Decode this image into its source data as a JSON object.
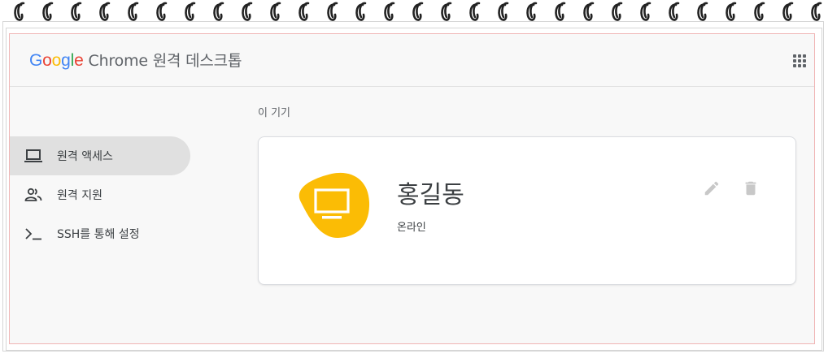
{
  "header": {
    "logo_letters": [
      "G",
      "o",
      "o",
      "g",
      "l",
      "e"
    ],
    "product": "Chrome 원격 데스크톱"
  },
  "nav": {
    "items": [
      {
        "label": "원격 액세스",
        "icon": "laptop-icon",
        "active": true
      },
      {
        "label": "원격 지원",
        "icon": "people-icon",
        "active": false
      },
      {
        "label": "SSH를 통해 설정",
        "icon": "terminal-icon",
        "active": false
      }
    ]
  },
  "main": {
    "section_title": "이 기기",
    "device": {
      "name": "홍길동",
      "status": "온라인",
      "icon": "monitor-icon",
      "blob_color": "#fbbc05"
    },
    "actions": [
      "edit-icon",
      "delete-icon"
    ]
  },
  "colors": {
    "accent": "#fbbc05",
    "active_nav_bg": "#e0e0e0",
    "action_icon": "#c8c8c8"
  }
}
